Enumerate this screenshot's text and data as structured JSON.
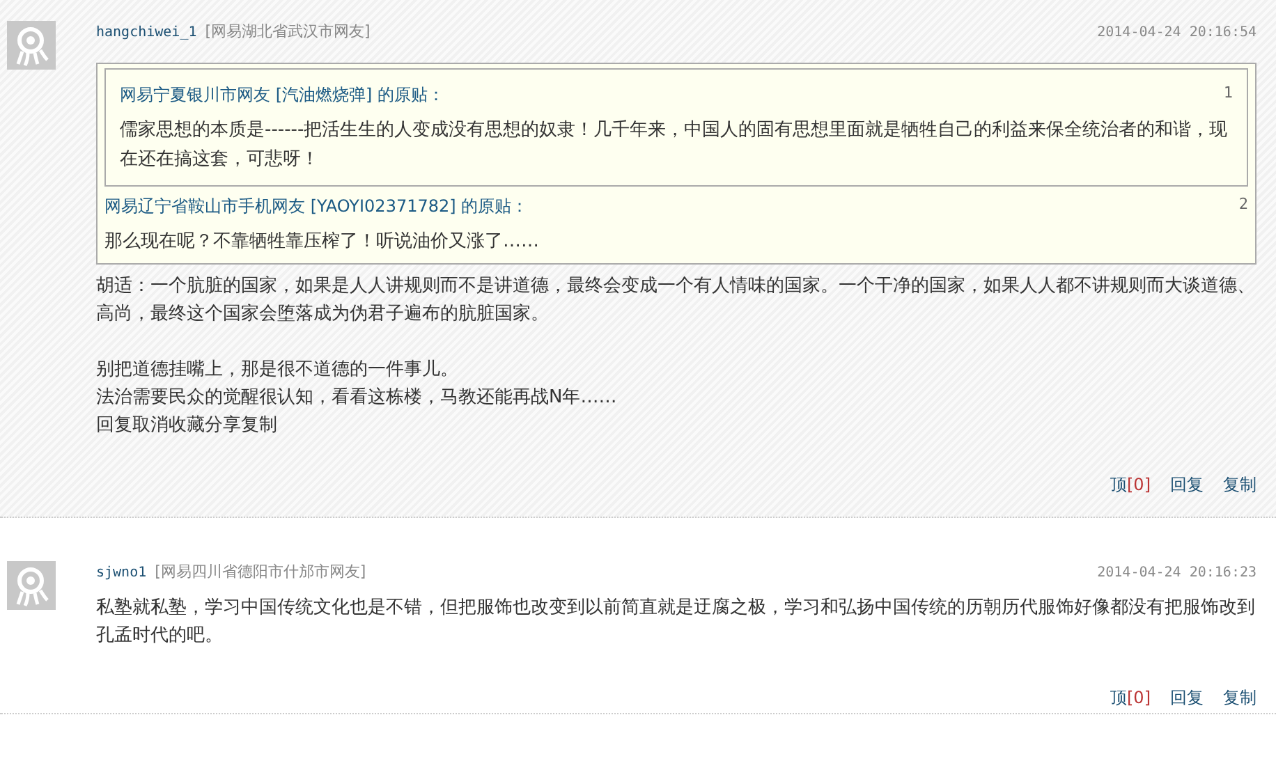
{
  "comments": [
    {
      "username": "hangchiwei_1",
      "location": "[网易湖北省武汉市网友]",
      "time": "2014-04-24 20:16:54",
      "highlighted": true,
      "quote": {
        "number": "2",
        "header": "网易辽宁省鞍山市手机网友 [YAOYI02371782] 的原贴：",
        "text": "那么现在呢？不靠牺牲靠压榨了！听说油价又涨了……",
        "quote": {
          "number": "1",
          "header": "网易宁夏银川市网友 [汽油燃烧弹] 的原贴：",
          "text": "儒家思想的本质是------把活生生的人变成没有思想的奴隶！几千年来，中国人的固有思想里面就是牺牲自己的利益来保全统治者的和谐，现在还在搞这套，可悲呀！"
        }
      },
      "blocks": [
        [
          "胡适：一个肮脏的国家，如果是人人讲规则而不是讲道德，最终会变成一个有人情味的国家。一个干净的国家，如果人人都不讲规则而大谈道德、高尚，最终这个国家会堕落成为伪君子遍布的肮脏国家。"
        ],
        [
          "别把道德挂嘴上，那是很不道德的一件事儿。",
          "法治需要民众的觉醒很认知，看看这栋楼，马教还能再战N年……",
          "回复取消收藏分享复制"
        ]
      ],
      "actions": {
        "upvote": "顶",
        "count": "[0]",
        "reply": "回复",
        "copy": "复制"
      }
    },
    {
      "username": "sjwno1",
      "location": "[网易四川省德阳市什邡市网友]",
      "time": "2014-04-24 20:16:23",
      "highlighted": false,
      "blocks": [
        [
          "私塾就私塾，学习中国传统文化也是不错，但把服饰也改变到以前简直就是迂腐之极，学习和弘扬中国传统的历朝历代服饰好像都没有把服饰改到孔孟时代的吧。"
        ]
      ],
      "actions": {
        "upvote": "顶",
        "count": "[0]",
        "reply": "回复",
        "copy": "复制"
      }
    }
  ]
}
